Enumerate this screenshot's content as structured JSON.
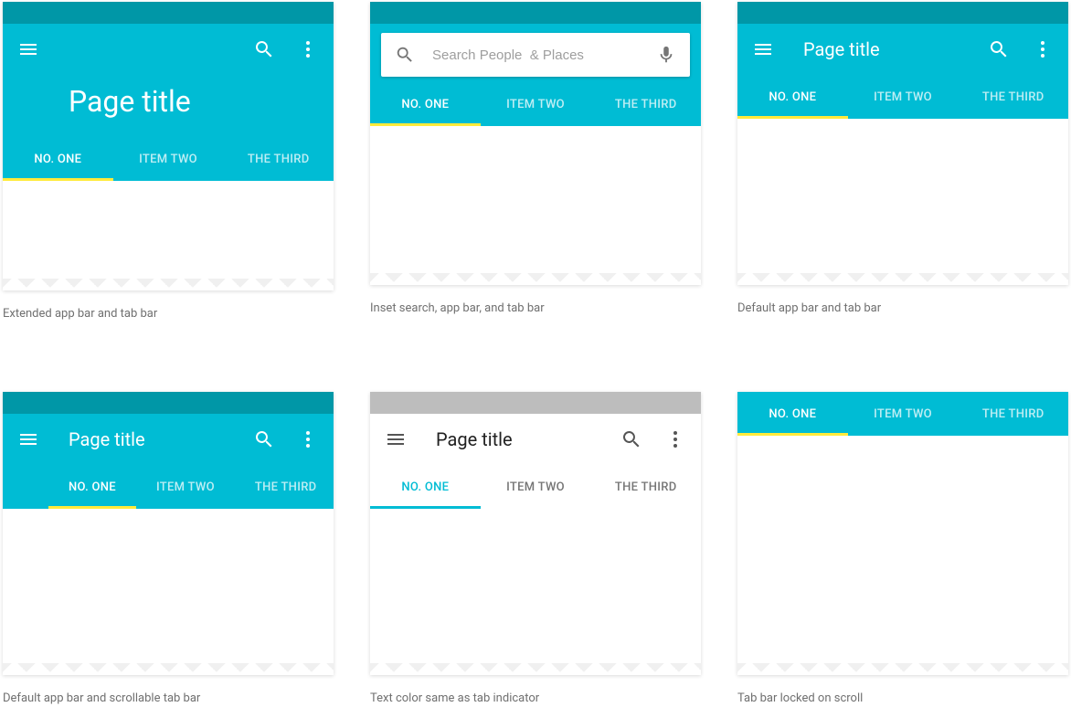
{
  "colors": {
    "primary": "#00bcd4",
    "primary_dark": "#0097a7",
    "accent": "#ffeb3b",
    "tab_indicator_alt": "#00bcd4",
    "grey_status": "#bdbdbd"
  },
  "common": {
    "page_title": "Page title",
    "tabs": [
      "NO. ONE",
      "ITEM TWO",
      "THE THIRD"
    ],
    "active_tab_index": 0,
    "search_placeholder": "Search People  & Places"
  },
  "panels": [
    {
      "id": "extended",
      "caption": "Extended app bar and tab bar"
    },
    {
      "id": "inset",
      "caption": "Inset search, app bar, and tab bar"
    },
    {
      "id": "default",
      "caption": "Default app bar and tab bar"
    },
    {
      "id": "scrollable",
      "caption": "Default app bar and scrollable tab bar"
    },
    {
      "id": "textcolor",
      "caption": "Text color same as tab indicator"
    },
    {
      "id": "locked",
      "caption": "Tab bar locked on scroll"
    }
  ]
}
